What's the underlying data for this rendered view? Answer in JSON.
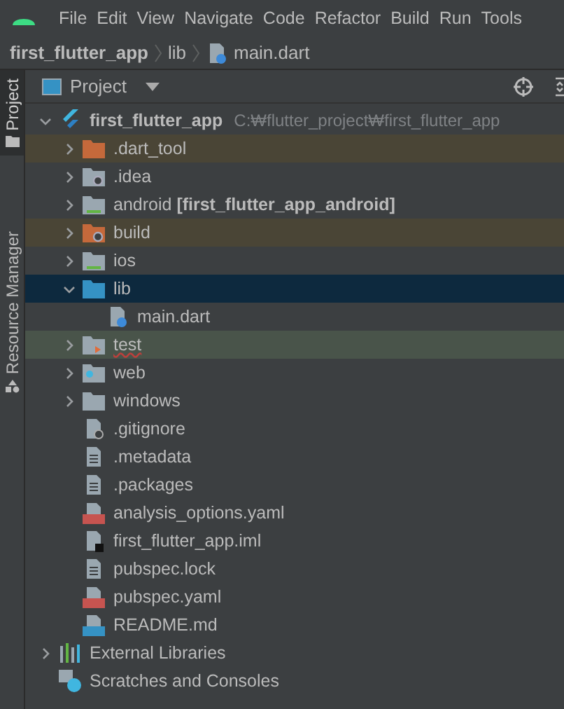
{
  "menu": [
    "File",
    "Edit",
    "View",
    "Navigate",
    "Code",
    "Refactor",
    "Build",
    "Run",
    "Tools"
  ],
  "breadcrumb": [
    "first_flutter_app",
    "lib",
    "main.dart"
  ],
  "side_tabs": [
    {
      "label": "Project",
      "selected": true
    },
    {
      "label": "Resource Manager",
      "selected": false
    }
  ],
  "panel": {
    "title": "Project"
  },
  "tree": [
    {
      "name": "first_flutter_app",
      "path": "C:₩flutter_project₩first_flutter_app",
      "kind": "project",
      "expanded": true,
      "selected": false,
      "children": [
        {
          "name": ".dart_tool",
          "kind": "excluded",
          "expanded": false,
          "selected": false
        },
        {
          "name": ".idea",
          "kind": "settings",
          "expanded": false,
          "selected": false
        },
        {
          "name": "android **[first_flutter_app_android]**",
          "kind": "module",
          "expanded": false,
          "selected": false
        },
        {
          "name": "build",
          "kind": "excluded-settings",
          "expanded": false,
          "selected": false
        },
        {
          "name": "ios",
          "kind": "module",
          "expanded": false,
          "selected": false
        },
        {
          "name": "lib",
          "kind": "source",
          "expanded": true,
          "selected": true,
          "children": [
            {
              "name": "main.dart",
              "kind": "dart",
              "selected": false
            }
          ]
        },
        {
          "name": "test",
          "kind": "test",
          "expanded": false,
          "selected": false
        },
        {
          "name": "web",
          "kind": "web",
          "expanded": false,
          "selected": false
        },
        {
          "name": "windows",
          "kind": "folder",
          "expanded": false,
          "selected": false
        },
        {
          "name": ".gitignore",
          "kind": "ignore",
          "selected": false
        },
        {
          "name": ".metadata",
          "kind": "text",
          "selected": false
        },
        {
          "name": ".packages",
          "kind": "text",
          "selected": false
        },
        {
          "name": "analysis_options.yaml",
          "kind": "yaml",
          "selected": false
        },
        {
          "name": "first_flutter_app.iml",
          "kind": "iml",
          "selected": false
        },
        {
          "name": "pubspec.lock",
          "kind": "text",
          "selected": false
        },
        {
          "name": "pubspec.yaml",
          "kind": "yaml",
          "selected": false
        },
        {
          "name": "README.md",
          "kind": "md",
          "selected": false
        }
      ]
    },
    {
      "name": "External Libraries",
      "kind": "libraries",
      "expanded": false,
      "selected": false
    },
    {
      "name": "Scratches and Consoles",
      "kind": "scratches",
      "selected": false
    }
  ]
}
